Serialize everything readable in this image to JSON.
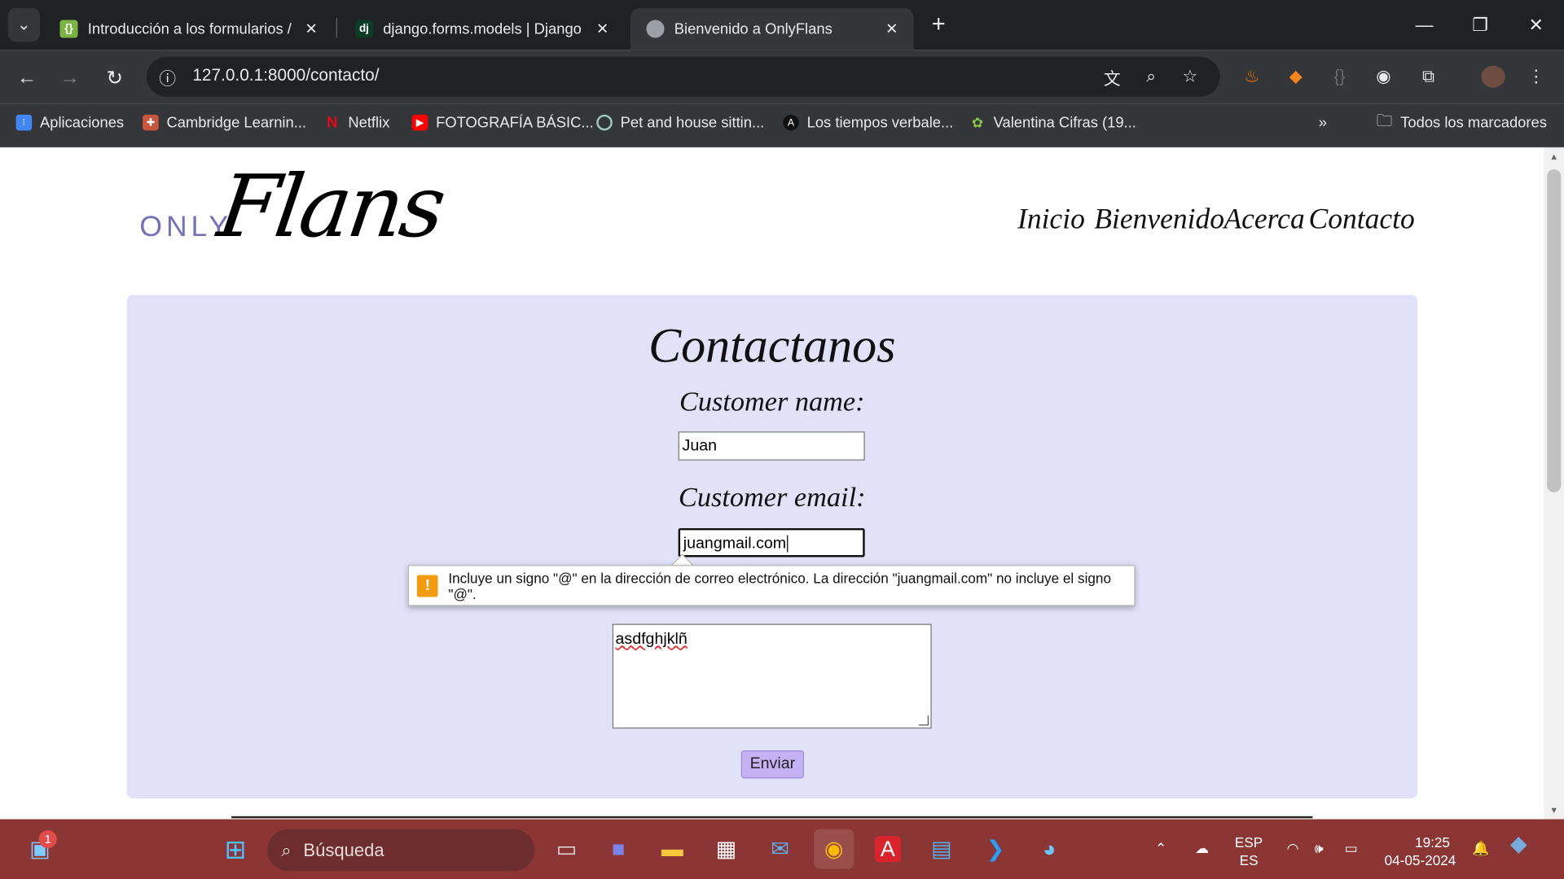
{
  "browser": {
    "tabs": [
      {
        "title": "Introducción a los formularios /",
        "favicon": "codepen-icon"
      },
      {
        "title": "django.forms.models | Django d",
        "favicon": "dj"
      },
      {
        "title": "Bienvenido a OnlyFlans",
        "favicon": "globe-icon"
      }
    ],
    "url": "127.0.0.1:8000/contacto/",
    "bookmarks": [
      "Aplicaciones",
      "Cambridge Learnin...",
      "Netflix",
      "FOTOGRAFÍA BÁSIC...",
      "Pet and house sittin...",
      "Los tiempos verbale...",
      "Valentina Cifras (19..."
    ],
    "all_bookmarks": "Todos los marcadores"
  },
  "site": {
    "logo_small": "ONLY",
    "logo_big": "Flans",
    "nav": [
      "Inicio",
      "Bienvenido",
      "Acerca",
      "Contacto"
    ]
  },
  "form": {
    "title": "Contactanos",
    "name_label": "Customer name:",
    "name_value": "Juan",
    "email_label": "Customer email:",
    "email_value": "juangmail.com",
    "message_value": "asdfghjklñ",
    "submit": "Enviar"
  },
  "validation": {
    "message": "Incluye un signo \"@\" en la dirección de correo electrónico. La dirección \"juangmail.com\" no incluye el signo \"@\"."
  },
  "taskbar": {
    "search_placeholder": "Búsqueda",
    "lang_top": "ESP",
    "lang_bottom": "ES",
    "time": "19:25",
    "date": "04-05-2024",
    "notification_count": "1"
  }
}
